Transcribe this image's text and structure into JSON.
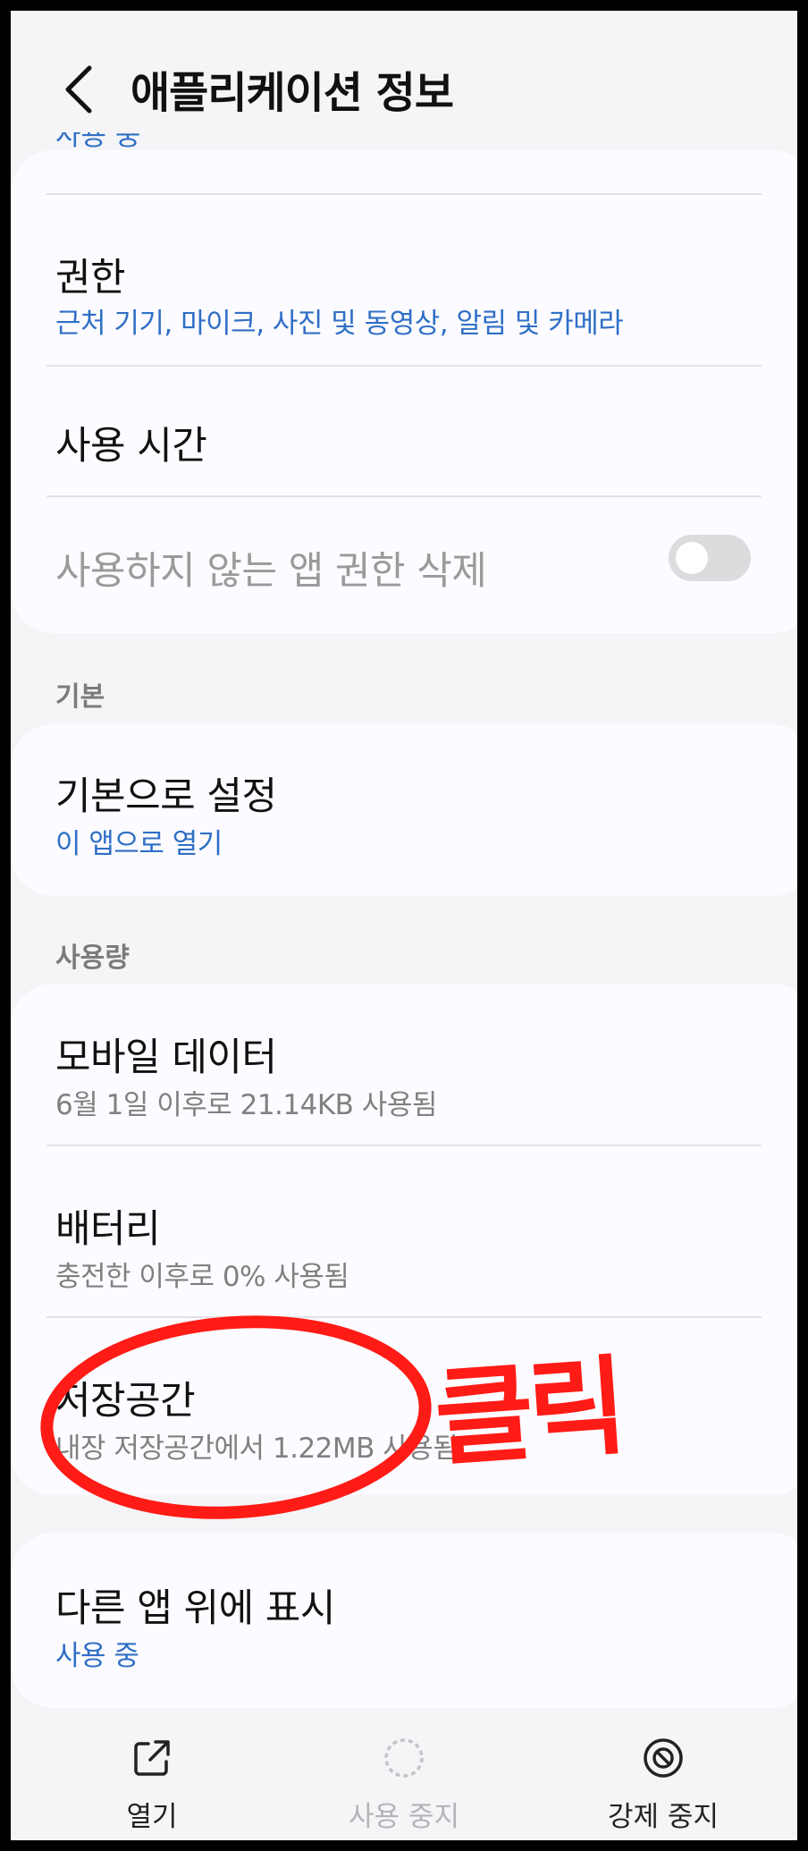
{
  "header": {
    "title": "애플리케이션 정보"
  },
  "top_card": {
    "partial_sub": "사용 중",
    "permissions": {
      "title": "권한",
      "sub": "근처 기기, 마이크, 사진 및 동영상, 알림 및 카메라"
    },
    "usage_time": {
      "title": "사용 시간"
    },
    "remove_perms": {
      "title": "사용하지 않는 앱 권한 삭제",
      "toggle_on": false
    }
  },
  "default_section": {
    "label": "기본",
    "set_default": {
      "title": "기본으로 설정",
      "sub": "이 앱으로 열기"
    }
  },
  "usage_section": {
    "label": "사용량",
    "mobile_data": {
      "title": "모바일 데이터",
      "sub": "6월 1일 이후로 21.14KB 사용됨"
    },
    "battery": {
      "title": "배터리",
      "sub": "충전한 이후로 0% 사용됨"
    },
    "storage": {
      "title": "저장공간",
      "sub": "내장 저장공간에서 1.22MB 사용됨"
    }
  },
  "overlay_card": {
    "display_over": {
      "title": "다른 앱 위에 표시",
      "sub": "사용 중"
    }
  },
  "bottom_nav": {
    "open": "열기",
    "disable": "사용 중지",
    "force_stop": "강제 중지"
  },
  "annotation": {
    "text": "클릭",
    "color": "#ff1b16"
  },
  "colors": {
    "accent_blue": "#2f6fc6",
    "background": "#f5f5f7",
    "card": "#fcfbff"
  },
  "icons": {
    "back": "chevron-left-icon",
    "open": "open-external-icon",
    "disable": "disable-dashed-circle-icon",
    "force_stop": "force-stop-icon"
  }
}
